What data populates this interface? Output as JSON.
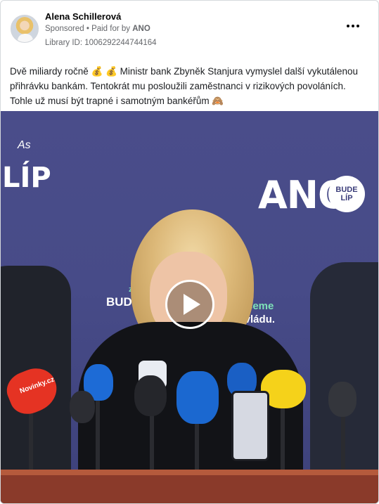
{
  "post": {
    "author": "Alena Schillerová",
    "sponsored": "Sponsored",
    "separator": "•",
    "paid_for_prefix": "Paid for by",
    "paid_for_name": "ANO",
    "library_id": "Library ID: 1006292244744164",
    "text_lines": [
      "Dvě miliardy ročně 💰 💰  Ministr bank Zbyněk Stanjura vymyslel další vykutálenou",
      "přihrávku bankám. Tentokrát mu posloužili zaměstnanci v rizikových povoláních.",
      "Tohle už musí být trapné i samotným bankéřům 🙈"
    ]
  },
  "video": {
    "brand": "ANO",
    "badge_line1": "BUDE",
    "badge_line2": "LÍP",
    "left_partial": "LÍP",
    "left_small": "As",
    "slogan_left": "BUDE",
    "slogan_small": "zr",
    "slogan_right_line1": "Chceme",
    "slogan_right_line2": "ší vládu.",
    "mic_label": "Novinky.cz"
  },
  "icons": {
    "more": "more-options-icon",
    "play": "play-icon"
  }
}
